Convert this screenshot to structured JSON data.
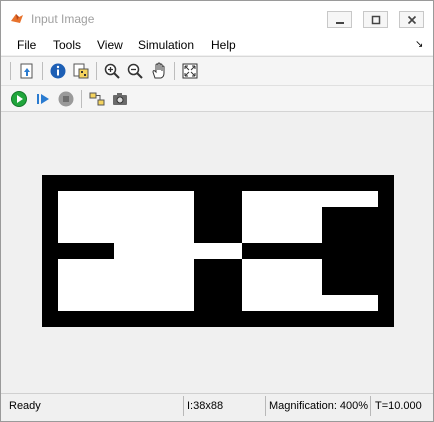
{
  "window": {
    "title": "Input Image"
  },
  "menu": {
    "items": [
      "File",
      "Tools",
      "View",
      "Simulation",
      "Help"
    ]
  },
  "toolbar": {
    "top_icons": [
      "export-icon",
      "info-icon",
      "pixel-region-icon",
      "zoom-in-icon",
      "zoom-out-icon",
      "pan-hand-icon",
      "fit-to-window-icon"
    ],
    "sim_icons": [
      "play-icon",
      "step-forward-icon",
      "stop-icon",
      "simulink-model-icon",
      "snapshot-camera-icon"
    ]
  },
  "status": {
    "state": "Ready",
    "image_info": "I:38x88",
    "magnification": "Magnification: 400%",
    "time": "T=10.000"
  },
  "colors": {
    "matlab_orange": "#e8722c",
    "play_green": "#21a63c",
    "step_blue": "#2a7bd0",
    "stop_gray": "#8a8a8a"
  }
}
